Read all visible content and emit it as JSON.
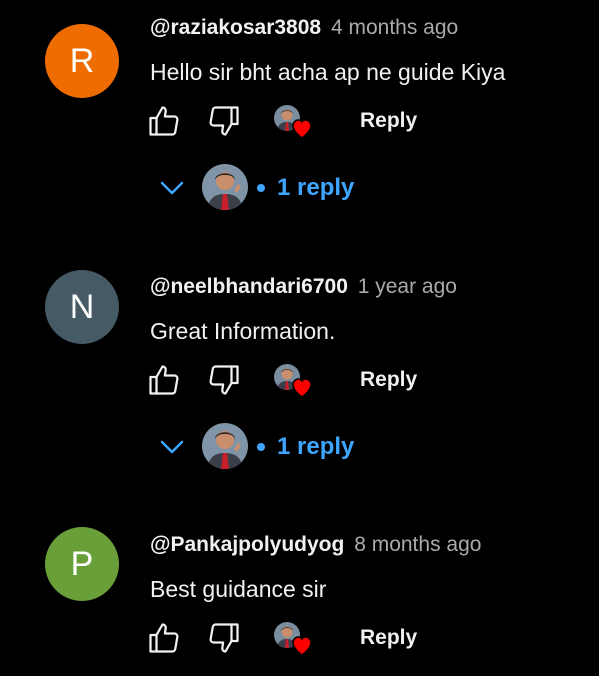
{
  "colors": {
    "background": "#000000",
    "link_blue": "#3ea6ff",
    "text_primary": "#f1f1f1",
    "text_secondary": "#aaaaaa",
    "heart_red": "#ff0000"
  },
  "comments": [
    {
      "avatar_letter": "R",
      "avatar_color": "#ef6c00",
      "handle": "@raziakosar3808",
      "time": "4 months ago",
      "text": "Hello sir bht acha ap ne guide Kiya",
      "reply_label": "Reply",
      "replies_label": "1 reply",
      "like_icon": "thumbs-up-icon",
      "dislike_icon": "thumbs-down-icon",
      "hearted": true
    },
    {
      "avatar_letter": "N",
      "avatar_color": "#455a64",
      "handle": "@neelbhandari6700",
      "time": "1 year ago",
      "text": "Great Information.",
      "reply_label": "Reply",
      "replies_label": "1 reply",
      "like_icon": "thumbs-up-icon",
      "dislike_icon": "thumbs-down-icon",
      "hearted": true
    },
    {
      "avatar_letter": "P",
      "avatar_color": "#689f38",
      "handle": "@Pankajpolyudyog",
      "time": "8 months ago",
      "text": "Best guidance sir",
      "reply_label": "Reply",
      "like_icon": "thumbs-up-icon",
      "dislike_icon": "thumbs-down-icon",
      "hearted": true
    }
  ]
}
